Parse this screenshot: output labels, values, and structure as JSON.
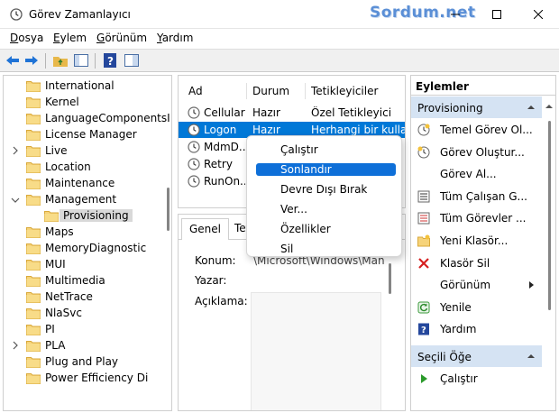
{
  "window": {
    "title": "Görev Zamanlayıcı",
    "watermark": "Sordum.net"
  },
  "menu": [
    {
      "label": "Dosya",
      "key": "D",
      "rest": "osya"
    },
    {
      "label": "Eylem",
      "key": "E",
      "rest": "ylem"
    },
    {
      "label": "Görünüm",
      "key": "G",
      "rest": "örünüm"
    },
    {
      "label": "Yardım",
      "key": "Y",
      "rest": "ardım"
    }
  ],
  "tree": {
    "items": [
      {
        "label": "International",
        "expandable": false
      },
      {
        "label": "Kernel",
        "expandable": false
      },
      {
        "label": "LanguageComponentsI",
        "expandable": false
      },
      {
        "label": "License Manager",
        "expandable": false
      },
      {
        "label": "Live",
        "expandable": true
      },
      {
        "label": "Location",
        "expandable": false
      },
      {
        "label": "Maintenance",
        "expandable": false
      },
      {
        "label": "Management",
        "expandable": true,
        "expanded": true
      },
      {
        "label": "Provisioning",
        "expandable": false,
        "child": true,
        "selected": true
      },
      {
        "label": "Maps",
        "expandable": false
      },
      {
        "label": "MemoryDiagnostic",
        "expandable": false
      },
      {
        "label": "MUI",
        "expandable": false
      },
      {
        "label": "Multimedia",
        "expandable": false
      },
      {
        "label": "NetTrace",
        "expandable": false
      },
      {
        "label": "NlaSvc",
        "expandable": false
      },
      {
        "label": "PI",
        "expandable": false
      },
      {
        "label": "PLA",
        "expandable": true
      },
      {
        "label": "Plug and Play",
        "expandable": false
      },
      {
        "label": "Power Efficiency Di",
        "expandable": false
      }
    ]
  },
  "tasks": {
    "columns": [
      "Ad",
      "Durum",
      "Tetikleyiciler"
    ],
    "rows": [
      {
        "name": "Cellular",
        "status": "Hazır",
        "trigger": "Özel Tetikleyici"
      },
      {
        "name": "Logon",
        "status": "Hazır",
        "trigger": "Herhangi bir kullanı",
        "selected": true
      },
      {
        "name": "MdmD...",
        "status": "",
        "trigger": ""
      },
      {
        "name": "Retry",
        "status": "",
        "trigger": ""
      },
      {
        "name": "RunOn...",
        "status": "",
        "trigger": ""
      }
    ]
  },
  "details": {
    "tabs": [
      "Genel",
      "Tet"
    ],
    "fields": {
      "location_label": "Konum:",
      "location_value": "\\Microsoft\\Windows\\Mana",
      "author_label": "Yazar:",
      "desc_label": "Açıklama:"
    }
  },
  "context_menu": {
    "items": [
      "Çalıştır",
      "Sonlandır",
      "Devre Dışı Bırak",
      "Ver...",
      "Özellikler",
      "Sil"
    ],
    "highlighted": 1
  },
  "actions": {
    "title": "Eylemler",
    "sections": [
      {
        "title": "Provisioning",
        "items": [
          {
            "label": "Temel Görev Ol...",
            "icon": "basic-task-icon"
          },
          {
            "label": "Görev Oluştur...",
            "icon": "create-task-icon"
          },
          {
            "label": "Görev Al...",
            "icon": ""
          },
          {
            "label": "Tüm Çalışan G...",
            "icon": "running-tasks-icon"
          },
          {
            "label": "Tüm Görevler ...",
            "icon": "all-tasks-history-icon"
          },
          {
            "label": "Yeni Klasör...",
            "icon": "new-folder-icon"
          },
          {
            "label": "Klasör Sil",
            "icon": "delete-folder-icon"
          },
          {
            "label": "Görünüm",
            "icon": "",
            "submenu": true
          },
          {
            "label": "Yenile",
            "icon": "refresh-icon"
          },
          {
            "label": "Yardım",
            "icon": "help-icon"
          }
        ]
      },
      {
        "title": "Seçili Öğe",
        "items": [
          {
            "label": "Çalıştır",
            "icon": "run-icon"
          }
        ]
      }
    ]
  },
  "colors": {
    "selection": "#0078d7",
    "context_highlight": "#0e6fd8",
    "action_section": "#d5e3f3",
    "watermark": "#5b8fd6"
  }
}
